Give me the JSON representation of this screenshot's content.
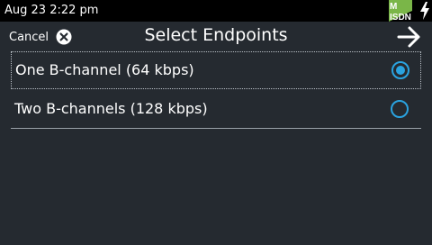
{
  "status_bar": {
    "time": "Aug 23 2:22 pm",
    "isdn_icon": {
      "name": "isdn-status-icon",
      "top_text": "M",
      "bottom_text": "ISDN",
      "color": "#7ab648"
    },
    "power_icon": "lightning-bolt-icon"
  },
  "header": {
    "cancel_label": "Cancel",
    "cancel_icon": "close-circle-icon",
    "title": "Select Endpoints",
    "next_icon": "arrow-right-icon"
  },
  "options": [
    {
      "label": "One B-channel (64 kbps)",
      "selected": true
    },
    {
      "label": "Two B-channels (128 kbps)",
      "selected": false
    }
  ],
  "colors": {
    "background": "#252a30",
    "status_bar": "#000000",
    "accent": "#2aa3e0",
    "separator": "#9aa1a8",
    "isdn_green": "#7ab648"
  }
}
